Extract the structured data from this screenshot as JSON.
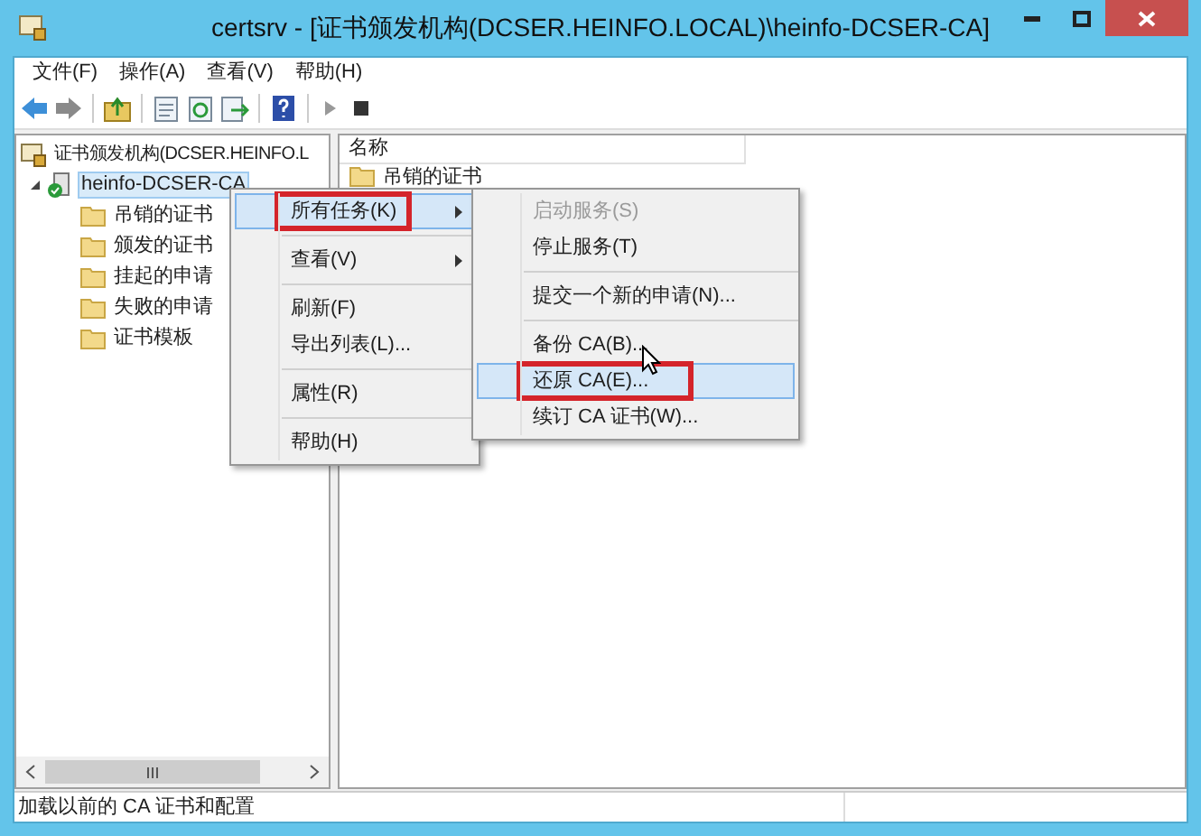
{
  "window": {
    "title": "certsrv - [证书颁发机构(DCSER.HEINFO.LOCAL)\\heinfo-DCSER-CA]"
  },
  "menu_bar": [
    "文件(F)",
    "操作(A)",
    "查看(V)",
    "帮助(H)"
  ],
  "tree": [
    {
      "label": "证书颁发机构(DCSER.HEINFO.L",
      "kind": "root",
      "selected": false,
      "children": [
        {
          "label": "heinfo-DCSER-CA",
          "kind": "ca",
          "selected": true,
          "expanded": true,
          "children": [
            {
              "label": "吊销的证书",
              "kind": "folder",
              "selected": false
            },
            {
              "label": "颁发的证书",
              "kind": "folder",
              "selected": false
            },
            {
              "label": "挂起的申请",
              "kind": "folder",
              "selected": false
            },
            {
              "label": "失败的申请",
              "kind": "folder",
              "selected": false
            },
            {
              "label": "证书模板",
              "kind": "folder",
              "selected": false
            }
          ]
        }
      ]
    }
  ],
  "list": {
    "columns": [
      "名称"
    ],
    "rows": [
      {
        "label": "吊销的证书"
      }
    ]
  },
  "context_menu": [
    {
      "kind": "item",
      "label": "所有任务(K)",
      "submenu": true,
      "selected": true,
      "marked": true
    },
    {
      "kind": "separator"
    },
    {
      "kind": "item",
      "label": "查看(V)",
      "submenu": true,
      "selected": false,
      "marked": false
    },
    {
      "kind": "separator"
    },
    {
      "kind": "item",
      "label": "刷新(F)",
      "submenu": false,
      "selected": false,
      "marked": false
    },
    {
      "kind": "item",
      "label": "导出列表(L)...",
      "submenu": false,
      "selected": false,
      "marked": false
    },
    {
      "kind": "separator"
    },
    {
      "kind": "item",
      "label": "属性(R)",
      "submenu": false,
      "selected": false,
      "marked": false
    },
    {
      "kind": "separator"
    },
    {
      "kind": "item",
      "label": "帮助(H)",
      "submenu": false,
      "selected": false,
      "marked": false
    }
  ],
  "submenu": [
    {
      "kind": "item",
      "label": "启动服务(S)",
      "disabled": true,
      "selected": false,
      "marked": false
    },
    {
      "kind": "item",
      "label": "停止服务(T)",
      "disabled": false,
      "selected": false,
      "marked": false
    },
    {
      "kind": "separator"
    },
    {
      "kind": "item",
      "label": "提交一个新的申请(N)...",
      "disabled": false,
      "selected": false,
      "marked": false
    },
    {
      "kind": "separator"
    },
    {
      "kind": "item",
      "label": "备份 CA(B)...",
      "disabled": false,
      "selected": false,
      "marked": false
    },
    {
      "kind": "item",
      "label": "还原 CA(E)...",
      "disabled": false,
      "selected": true,
      "marked": true
    },
    {
      "kind": "item",
      "label": "续订 CA 证书(W)...",
      "disabled": false,
      "selected": false,
      "marked": false
    }
  ],
  "status_bar": "加载以前的 CA 证书和配置"
}
